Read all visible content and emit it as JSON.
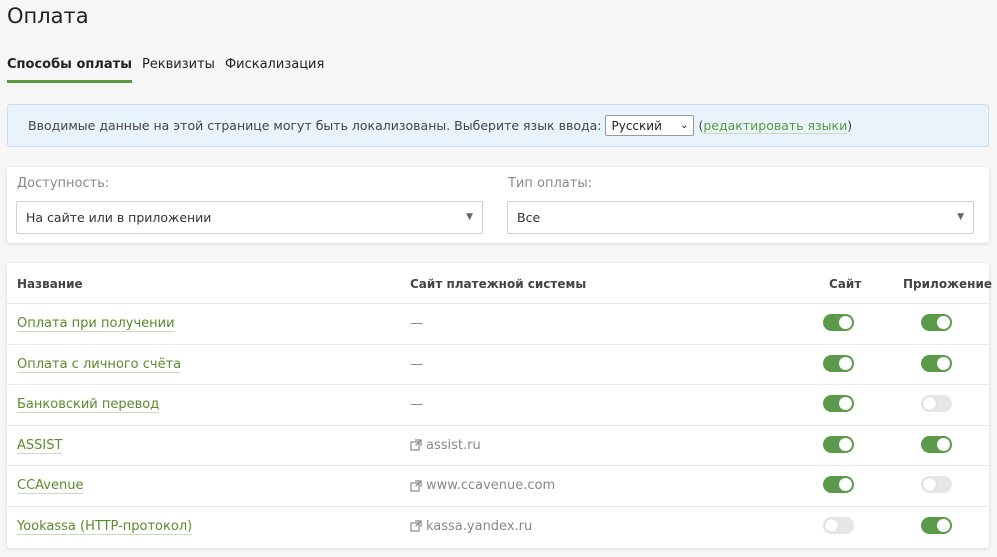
{
  "page": {
    "title": "Оплата"
  },
  "tabs": [
    {
      "label": "Способы оплаты",
      "active": true
    },
    {
      "label": "Реквизиты",
      "active": false
    },
    {
      "label": "Фискализация",
      "active": false
    }
  ],
  "info": {
    "text": "Вводимые данные на этой странице могут быть локализованы. Выберите язык ввода:",
    "language": "Русский",
    "open_paren": "(",
    "edit_link": "редактировать языки",
    "close_paren": ")"
  },
  "filters": {
    "availability": {
      "label": "Доступность:",
      "value": "На сайте или в приложении"
    },
    "payment_type": {
      "label": "Тип оплаты:",
      "value": "Все"
    }
  },
  "table": {
    "headers": {
      "name": "Название",
      "site": "Сайт платежной системы",
      "web": "Сайт",
      "app": "Приложение"
    },
    "rows": [
      {
        "name": "Оплата при получении",
        "site": "—",
        "link": false,
        "web": true,
        "app": true
      },
      {
        "name": "Оплата с личного счёта",
        "site": "—",
        "link": false,
        "web": true,
        "app": true
      },
      {
        "name": "Банковский перевод",
        "site": "—",
        "link": false,
        "web": true,
        "app": false
      },
      {
        "name": "ASSIST",
        "site": "assist.ru",
        "link": true,
        "web": true,
        "app": true
      },
      {
        "name": "CCAvenue",
        "site": "www.ccavenue.com",
        "link": true,
        "web": true,
        "app": false
      },
      {
        "name": "Yookassa (HTTP-протокол)",
        "site": "kassa.yandex.ru",
        "link": true,
        "web": false,
        "app": true
      }
    ]
  },
  "colors": {
    "accent": "#5a9a3c",
    "toggle_on": "#5b9a4a",
    "toggle_off": "#e6e6e6",
    "info_bg": "#e8f3fb"
  }
}
